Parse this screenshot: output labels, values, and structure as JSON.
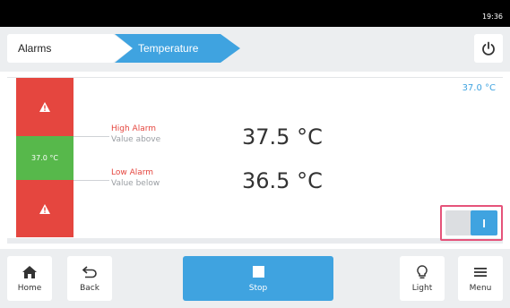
{
  "status": {
    "time": "19:36"
  },
  "breadcrumb": {
    "alarms": "Alarms",
    "temperature": "Temperature"
  },
  "panel": {
    "current_value": "37.0 °C",
    "bar_value": "37.0 °C",
    "high": {
      "title": "High Alarm",
      "subtitle": "Value above",
      "value": "37.5 °C"
    },
    "low": {
      "title": "Low Alarm",
      "subtitle": "Value below",
      "value": "36.5 °C"
    },
    "toggle_label": "I"
  },
  "toolbar": {
    "home": "Home",
    "back": "Back",
    "stop": "Stop",
    "light": "Light",
    "menu": "Menu"
  },
  "colors": {
    "accent": "#3fa3e0",
    "alarm": "#e5463f",
    "ok": "#57b84b",
    "highlight": "#e5537a"
  },
  "icons": [
    "power-icon",
    "warning-icon",
    "home-icon",
    "back-arrow-icon",
    "stop-icon",
    "lightbulb-icon",
    "menu-icon"
  ]
}
